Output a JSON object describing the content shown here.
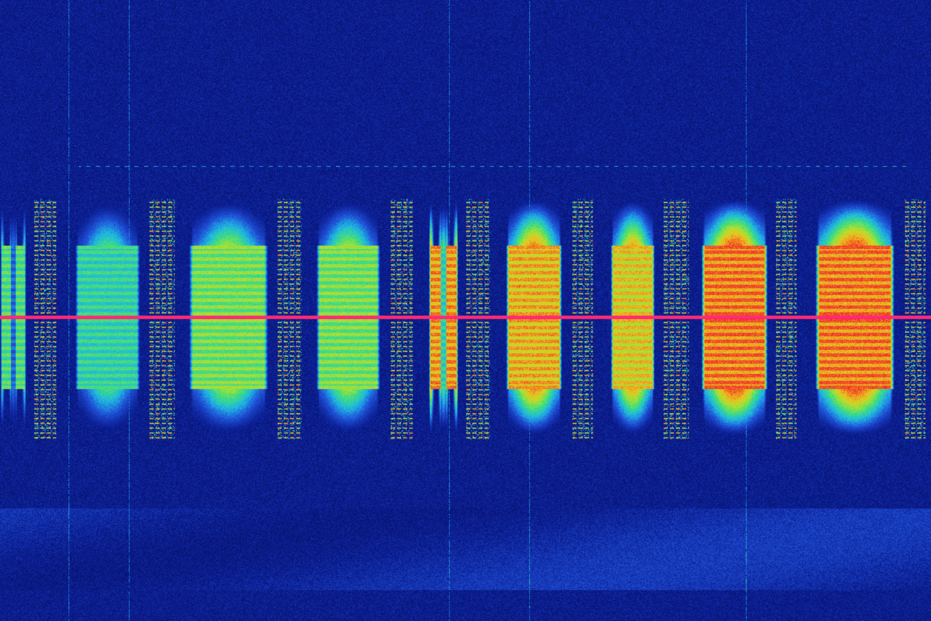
{
  "image": {
    "kind": "waterfall-spectrogram",
    "colormap": [
      "#060b45",
      "#0a1a8c",
      "#1f4fd6",
      "#1fb8e6",
      "#3ee07a",
      "#b8e02a",
      "#f0c020",
      "#f06a20",
      "#f02a2a",
      "#ff1e78"
    ],
    "background_color": "#060b45",
    "center_line_color": "#ff2d7a",
    "bursts": [
      {
        "intensity": 0.45,
        "kind": "voice"
      },
      {
        "intensity": 0.55,
        "kind": "voice"
      },
      {
        "intensity": 0.55,
        "kind": "voice"
      },
      {
        "intensity": 0.8,
        "kind": "voice-split"
      },
      {
        "intensity": 0.75,
        "kind": "voice"
      },
      {
        "intensity": 0.7,
        "kind": "voice"
      },
      {
        "intensity": 0.85,
        "kind": "voice"
      },
      {
        "intensity": 0.85,
        "kind": "voice"
      },
      {
        "intensity": 1.0,
        "kind": "voice-split"
      }
    ]
  }
}
